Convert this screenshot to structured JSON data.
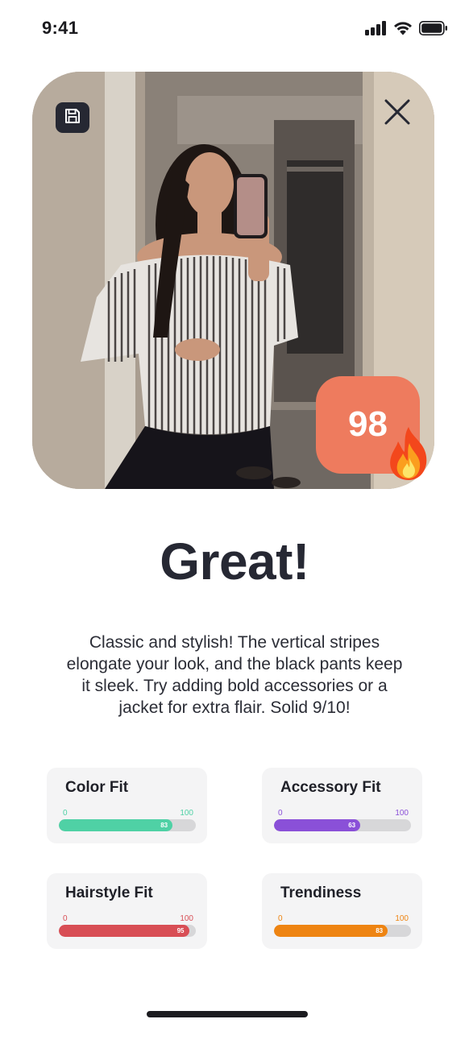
{
  "status_bar": {
    "time": "9:41"
  },
  "photo": {
    "description_icons": [
      "save-icon",
      "close-icon"
    ],
    "score": "98",
    "score_color": "#ee7b5e"
  },
  "result": {
    "verdict": "Great!",
    "feedback": "Classic and stylish! The vertical stripes elongate your look, and the black pants keep it sleek. Try adding bold accessories or a jacket for extra flair. Solid 9/10!"
  },
  "metrics": [
    {
      "label": "Color Fit",
      "min": "0",
      "max": "100",
      "value": 83,
      "value_label": "83",
      "color": "#4fd1a5"
    },
    {
      "label": "Accessory Fit",
      "min": "0",
      "max": "100",
      "value": 63,
      "value_label": "63",
      "color": "#8a50d8"
    },
    {
      "label": "Hairstyle Fit",
      "min": "0",
      "max": "100",
      "value": 95,
      "value_label": "95",
      "color": "#d84e55"
    },
    {
      "label": "Trendiness",
      "min": "0",
      "max": "100",
      "value": 83,
      "value_label": "83",
      "color": "#ee8412"
    }
  ]
}
